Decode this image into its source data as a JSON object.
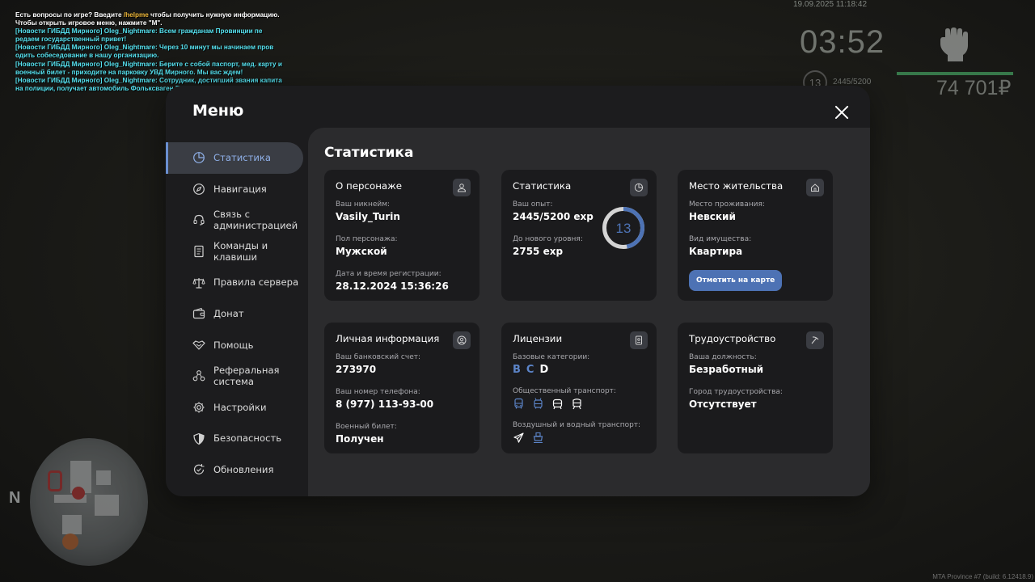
{
  "hud": {
    "chat": [
      {
        "segments": [
          {
            "text": "Есть вопросы по игре? Введите ",
            "c": "white"
          },
          {
            "text": "/helpme",
            "c": "hl"
          },
          {
            "text": " чтобы получить нужную информацию.",
            "c": "white"
          }
        ]
      },
      {
        "segments": [
          {
            "text": "Чтобы открыть игровое меню, нажмите \"M\".",
            "c": "white"
          }
        ]
      },
      {
        "segments": [
          {
            "text": "[Новости ГИБДД Мирного] Oleg_Nightmare: Всем гражданам Провинции пе",
            "c": "cyan"
          }
        ]
      },
      {
        "segments": [
          {
            "text": "редаем государственный привет!",
            "c": "cyan"
          }
        ]
      },
      {
        "segments": [
          {
            "text": "[Новости ГИБДД Мирного] Oleg_Nightmare: Через 10 минут мы начинаем пров",
            "c": "cyan"
          }
        ]
      },
      {
        "segments": [
          {
            "text": "одить собеседование в нашу организацию.",
            "c": "cyan"
          }
        ]
      },
      {
        "segments": [
          {
            "text": "[Новости ГИБДД Мирного] Oleg_Nightmare: Берите с собой паспорт, мед. карту и",
            "c": "cyan"
          }
        ]
      },
      {
        "segments": [
          {
            "text": " военный билет - приходите на парковку УВД Мирного. Мы вас ждем!",
            "c": "cyan"
          }
        ]
      },
      {
        "segments": [
          {
            "text": "[Новости ГИБДД Мирного] Oleg_Nightmare: Сотрудник, достигший звания капита",
            "c": "cyan"
          }
        ]
      },
      {
        "segments": [
          {
            "text": "на полиции, получает автомобиль Фольксваген Поло.",
            "c": "cyan"
          }
        ]
      }
    ],
    "datetime": "19.09.2025 11:18:42",
    "clock": "03:52",
    "level": "13",
    "exp": "2445/5200",
    "money": "74 701₽",
    "build": "MTA Province #7 (build: 6.12418.9)",
    "minimap_north": "N"
  },
  "menu": {
    "title": "Меню",
    "nav": [
      {
        "label": "Статистика",
        "icon": "pie-chart-icon",
        "active": true
      },
      {
        "label": "Навигация",
        "icon": "compass-icon"
      },
      {
        "label": "Связь с администрацией",
        "icon": "headset-icon"
      },
      {
        "label": "Команды и клавиши",
        "icon": "document-icon"
      },
      {
        "label": "Правила сервера",
        "icon": "scales-icon"
      },
      {
        "label": "Донат",
        "icon": "wallet-icon"
      },
      {
        "label": "Помощь",
        "icon": "handshake-icon"
      },
      {
        "label": "Реферальная система",
        "icon": "network-icon"
      },
      {
        "label": "Настройки",
        "icon": "gear-icon"
      },
      {
        "label": "Безопасность",
        "icon": "shield-icon"
      },
      {
        "label": "Обновления",
        "icon": "refresh-icon"
      }
    ]
  },
  "content": {
    "title": "Статистика",
    "character": {
      "title": "О персонаже",
      "nick_label": "Ваш никнейм:",
      "nick": "Vasily_Turin",
      "gender_label": "Пол персонажа:",
      "gender": "Мужской",
      "reg_label": "Дата и время регистрации:",
      "reg": "28.12.2024 15:36:26"
    },
    "stats": {
      "title": "Статистика",
      "exp_label": "Ваш опыт:",
      "exp": "2445/5200 exp",
      "next_label": "До нового уровня:",
      "next": "2755 exp",
      "level": "13",
      "progress": 0.47
    },
    "residence": {
      "title": "Место жительства",
      "place_label": "Место проживания:",
      "place": "Невский",
      "property_label": "Вид имущества:",
      "property": "Квартира",
      "map_button": "Отметить на карте"
    },
    "personal": {
      "title": "Личная информация",
      "bank_label": "Ваш банковский счет:",
      "bank": "273970",
      "phone_label": "Ваш номер телефона:",
      "phone": "8 (977) 113-93-00",
      "military_label": "Военный билет:",
      "military": "Получен"
    },
    "licenses": {
      "title": "Лицензии",
      "base_label": "Базовые категории:",
      "categories": [
        {
          "name": "B",
          "owned": true
        },
        {
          "name": "C",
          "owned": true
        },
        {
          "name": "D",
          "owned": false
        }
      ],
      "public_label": "Общественный транспорт:",
      "air_label": "Воздушный и водный транспорт:"
    },
    "employment": {
      "title": "Трудоустройство",
      "position_label": "Ваша должность:",
      "position": "Безработный",
      "city_label": "Город трудоустройства:",
      "city": "Отсутствует"
    }
  },
  "colors": {
    "accent": "#4d72b4",
    "accent_light": "#8fb0e8",
    "panel": "#1c1c1e",
    "content": "#2b2b2d",
    "card": "#1b1b1d"
  }
}
